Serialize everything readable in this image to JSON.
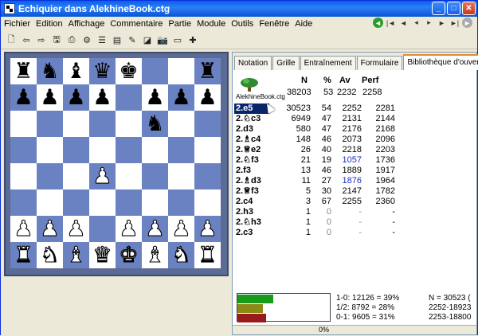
{
  "window": {
    "title": "Echiquier dans AlekhineBook.ctg",
    "buttons": {
      "minimize": "_",
      "maximize": "□",
      "close": "✕"
    }
  },
  "menu": [
    "Fichier",
    "Edition",
    "Affichage",
    "Commentaire",
    "Partie",
    "Module",
    "Outils",
    "Fenêtre",
    "Aide"
  ],
  "nav_icons": [
    "circle-arrow-left-icon",
    "first-move-icon",
    "previous-move-icon",
    "back-move-icon",
    "forward-move-icon",
    "next-move-icon",
    "last-move-icon",
    "circle-arrow-right-icon"
  ],
  "nav_glyphs": [
    "◄",
    "|◄",
    "◄",
    "◂",
    "▸",
    "►",
    "►|",
    "►"
  ],
  "toolbar_icons": [
    "new-document-icon",
    "arrow-back-icon",
    "arrow-forward-icon",
    "save-icon",
    "print-icon",
    "engine-icon",
    "settings-icon",
    "database-icon",
    "eraser-icon",
    "comment-icon",
    "camera-icon",
    "delete-icon",
    "plus-icon"
  ],
  "toolbar_glyphs": [
    "🗋",
    "⇦",
    "⇨",
    "🖫",
    "⎙",
    "⚙",
    "☰",
    "▤",
    "✎",
    "◪",
    "📷",
    "▭",
    "✚"
  ],
  "board": {
    "light_color": "#ffffff",
    "dark_color": "#6b82c2",
    "rows": [
      [
        "bR",
        "bN",
        "bB",
        "bQ",
        "bK",
        "",
        "",
        "bR"
      ],
      [
        "bP",
        "bP",
        "bP",
        "bP",
        "",
        "bP",
        "bP",
        "bP"
      ],
      [
        "",
        "",
        "",
        "",
        "",
        "bN",
        "",
        ""
      ],
      [
        "",
        "",
        "",
        "",
        "",
        "",
        "",
        ""
      ],
      [
        "",
        "",
        "",
        "wP",
        "",
        "",
        "",
        ""
      ],
      [
        "",
        "",
        "",
        "",
        "",
        "",
        "",
        ""
      ],
      [
        "wP",
        "wP",
        "wP",
        "",
        "wP",
        "wP",
        "wP",
        "wP"
      ],
      [
        "wR",
        "wN",
        "wB",
        "wQ",
        "wK",
        "wB",
        "wN",
        "wR"
      ]
    ]
  },
  "tabs": [
    "Notation",
    "Grille",
    "Entraînement",
    "Formulaire",
    "Bibliothèque d'ouvertures"
  ],
  "book": {
    "name": "AlekhineBook.ctg",
    "headers": {
      "n": "N",
      "pct": "%",
      "av": "Av",
      "perf": "Perf"
    },
    "totals": {
      "n": "38203",
      "pct": "53",
      "av": "2232",
      "perf": "2258"
    },
    "moves": [
      {
        "move": "2.e5",
        "n": "30523",
        "pct": "54",
        "av": "2252",
        "perf": "2281",
        "selected": true
      },
      {
        "move": "2.♘c3",
        "n": "6949",
        "pct": "47",
        "av": "2131",
        "perf": "2144"
      },
      {
        "move": "2.d3",
        "n": "580",
        "pct": "47",
        "av": "2176",
        "perf": "2168"
      },
      {
        "move": "2.♗c4",
        "n": "148",
        "pct": "46",
        "av": "2073",
        "perf": "2096"
      },
      {
        "move": "2.♕e2",
        "n": "26",
        "pct": "40",
        "av": "2218",
        "perf": "2203"
      },
      {
        "move": "2.♘f3",
        "n": "21",
        "pct": "19",
        "av": "1057",
        "perf": "1736",
        "av_blue": true
      },
      {
        "move": "2.f3",
        "n": "13",
        "pct": "46",
        "av": "1889",
        "perf": "1917"
      },
      {
        "move": "2.♗d3",
        "n": "11",
        "pct": "27",
        "av": "1876",
        "perf": "1964",
        "av_blue": true
      },
      {
        "move": "2.♕f3",
        "n": "5",
        "pct": "30",
        "av": "2147",
        "perf": "1782"
      },
      {
        "move": "2.c4",
        "n": "3",
        "pct": "67",
        "av": "2255",
        "perf": "2360"
      },
      {
        "move": "2.h3",
        "n": "1",
        "pct": "0",
        "av": "-",
        "perf": "-"
      },
      {
        "move": "2.♘h3",
        "n": "1",
        "pct": "0",
        "av": "-",
        "perf": "-"
      },
      {
        "move": "2.c3",
        "n": "1",
        "pct": "0",
        "av": "-",
        "perf": "-"
      }
    ]
  },
  "stats": {
    "bar_colors": [
      "#1a9a1a",
      "#8a8a16",
      "#9a1a1a"
    ],
    "bar_fractions": [
      0.39,
      0.28,
      0.31
    ],
    "lines": [
      "1-0:  12126 = 39%",
      "1/2:   8792 = 28%",
      "0-1:   9605 = 31%"
    ],
    "right_lines": [
      "N = 30523 (",
      "2252-18923",
      "2253-18800"
    ]
  },
  "status": {
    "progress": "0%"
  }
}
